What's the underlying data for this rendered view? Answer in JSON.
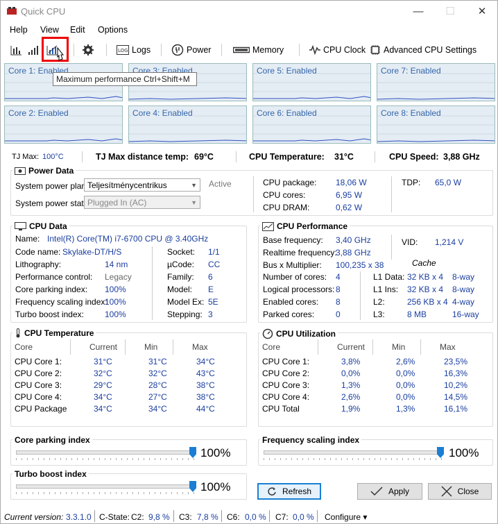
{
  "window": {
    "title": "Quick CPU",
    "minimize": "—",
    "maximize": "☐",
    "close": "✕"
  },
  "menu": [
    "Help",
    "View",
    "Edit",
    "Options"
  ],
  "toolbar": {
    "logs": "Logs",
    "power": "Power",
    "memory": "Memory",
    "cpu_clock": "CPU Clock",
    "advanced": "Advanced CPU Settings"
  },
  "tooltip": "Maximum performance Ctrl+Shift+M",
  "cores": [
    "Core 1: Enabled",
    "Core 3: Enabled",
    "Core 5: Enabled",
    "Core 7: Enabled",
    "Core 2: Enabled",
    "Core 4: Enabled",
    "Core 6: Enabled",
    "Core 8: Enabled"
  ],
  "summary": {
    "tjmax_label": "TJ Max:",
    "tjmax_value": "100°C",
    "tjdist_label": "TJ Max distance temp:",
    "tjdist_value": "69°C",
    "cputemp_label": "CPU Temperature:",
    "cputemp_value": "31°C",
    "cpuspeed_label": "CPU Speed:",
    "cpuspeed_value": "3,88 GHz"
  },
  "power": {
    "title": "Power Data",
    "plan_label": "System power plan:",
    "plan_value": "Teljesítménycentrikus",
    "active": "Active",
    "state_label": "System power state:",
    "state_value": "Plugged In (AC)",
    "pkg_label": "CPU package:",
    "pkg_value": "18,06 W",
    "cores_label": "CPU cores:",
    "cores_value": "6,95 W",
    "dram_label": "CPU DRAM:",
    "dram_value": "0,62 W",
    "tdp_label": "TDP:",
    "tdp_value": "65,0 W"
  },
  "cpu": {
    "title": "CPU Data",
    "name_label": "Name:",
    "name_value": "Intel(R) Core(TM) i7-6700 CPU @ 3.40GHz",
    "left": [
      [
        "Code name:",
        "Skylake-DT/H/S"
      ],
      [
        "Lithography:",
        "14 nm"
      ],
      [
        "Performance control:",
        "Legacy"
      ],
      [
        "Core parking index:",
        "100%"
      ],
      [
        "Frequency scaling index:",
        "100%"
      ],
      [
        "Turbo boost index:",
        "100%"
      ]
    ],
    "right": [
      [
        "Socket:",
        "1/1"
      ],
      [
        "µCode:",
        "CC"
      ],
      [
        "Family:",
        "6"
      ],
      [
        "Model:",
        "E"
      ],
      [
        "Model Ex:",
        "5E"
      ],
      [
        "Stepping:",
        "3"
      ]
    ]
  },
  "perf": {
    "title": "CPU Performance",
    "base_label": "Base frequency:",
    "base_value": "3,40 GHz",
    "vid_label": "VID:",
    "vid_value": "1,214 V",
    "real_label": "Realtime frequency:",
    "real_value": "3,88 GHz",
    "cache": "Cache",
    "bus_label": "Bus x Multiplier:",
    "bus_value": "100,235 x 38",
    "left": [
      [
        "Number of cores:",
        "4"
      ],
      [
        "Logical processors:",
        "8"
      ],
      [
        "Enabled cores:",
        "8"
      ],
      [
        "Parked cores:",
        "0"
      ]
    ],
    "cache_rows": [
      [
        "L1 Data:",
        "32 KB x 4",
        "8-way"
      ],
      [
        "L1 Ins:",
        "32 KB x 4",
        "8-way"
      ],
      [
        "L2:",
        "256 KB x 4",
        "4-way"
      ],
      [
        "L3:",
        "8 MB",
        "16-way"
      ]
    ]
  },
  "temp": {
    "title": "CPU Temperature",
    "headers": [
      "Core",
      "Current",
      "Min",
      "Max"
    ],
    "rows": [
      [
        "CPU Core 1:",
        "31°C",
        "31°C",
        "34°C"
      ],
      [
        "CPU Core 2:",
        "32°C",
        "32°C",
        "43°C"
      ],
      [
        "CPU Core 3:",
        "29°C",
        "28°C",
        "38°C"
      ],
      [
        "CPU Core 4:",
        "34°C",
        "27°C",
        "38°C"
      ],
      [
        "CPU Package",
        "34°C",
        "34°C",
        "44°C"
      ]
    ]
  },
  "util": {
    "title": "CPU Utilization",
    "headers": [
      "Core",
      "Current",
      "Min",
      "Max"
    ],
    "rows": [
      [
        "CPU Core 1:",
        "3,8%",
        "2,6%",
        "23,5%"
      ],
      [
        "CPU Core 2:",
        "0,0%",
        "0,0%",
        "16,3%"
      ],
      [
        "CPU Core 3:",
        "1,3%",
        "0,0%",
        "10,2%"
      ],
      [
        "CPU Core 4:",
        "2,6%",
        "0,0%",
        "14,5%"
      ],
      [
        "CPU Total",
        "1,9%",
        "1,3%",
        "16,1%"
      ]
    ]
  },
  "sliders": {
    "parking_label": "Core parking index",
    "parking_value": "100%",
    "parking_level": 1.0,
    "freq_label": "Frequency scaling index",
    "freq_value": "100%",
    "freq_level": 1.0,
    "turbo_label": "Turbo boost index",
    "turbo_value": "100%",
    "turbo_level": 1.0
  },
  "buttons": {
    "refresh": "Refresh",
    "apply": "Apply",
    "close": "Close"
  },
  "status": {
    "version_label": "Current version:",
    "version": "3.3.1.0",
    "cstate": "C-State:",
    "c2_label": "C2:",
    "c2": "9,8 %",
    "c3_label": "C3:",
    "c3": "7,8 %",
    "c6_label": "C6:",
    "c6": "0,0 %",
    "c7_label": "C7:",
    "c7": "0,0 %",
    "configure": "Configure ▾"
  },
  "colors": {
    "accent": "#1a7fd4",
    "value_blue": "#1a3ea0",
    "graph_bg": "#e4ecf4",
    "highlight": "#e00000"
  }
}
